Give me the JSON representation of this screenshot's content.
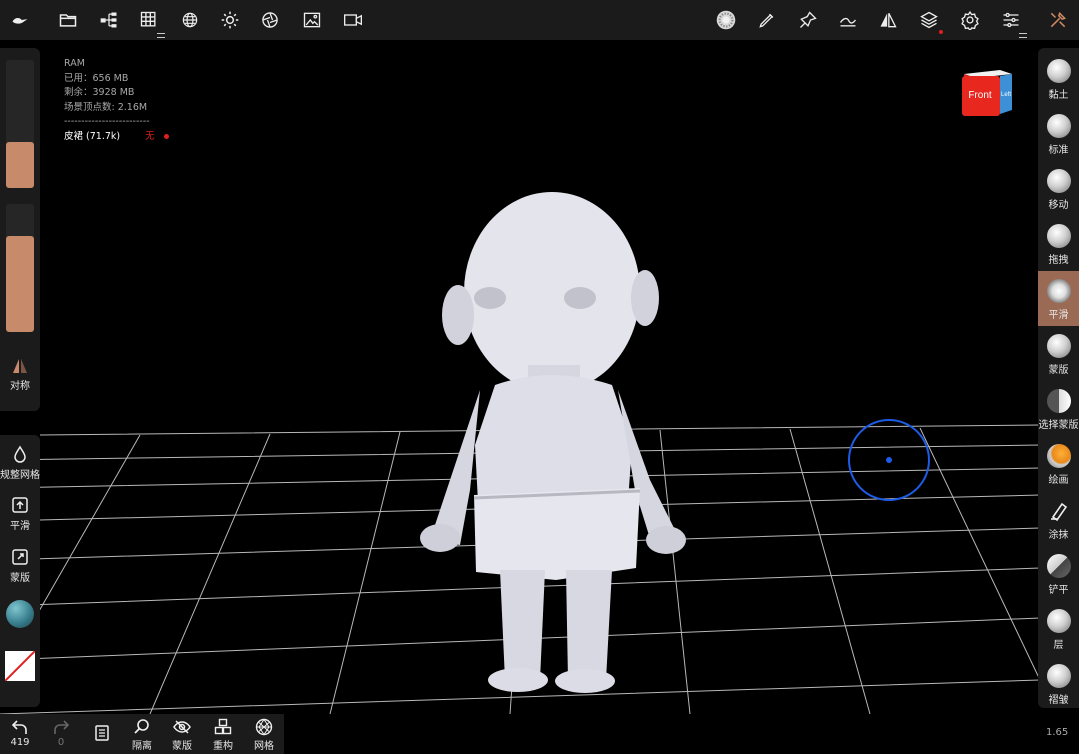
{
  "stats": {
    "ram_label": "RAM",
    "used": "已用：656 MB",
    "free": "剩余：3928 MB",
    "vertices": "场景顶点数: 2.16M",
    "divider": "-------------------------",
    "object_name": "皮裙 (71.7k)",
    "object_state": "无"
  },
  "view_cube": {
    "front_label": "Front",
    "side_label": "Left"
  },
  "left_panel": {
    "symmetry_label": "对称",
    "slider_top_level": 0.36,
    "slider_bottom_level": 0.75
  },
  "left_panel2": {
    "items": [
      {
        "label": "规整网格",
        "icon": "drop-icon"
      },
      {
        "label": "平滑",
        "icon": "upload-box-icon"
      },
      {
        "label": "蒙版",
        "icon": "corner-box-icon"
      }
    ],
    "material_color": "#3a7f8e",
    "color_swatch": "#ffffff"
  },
  "right_tools": [
    {
      "label": "黏土",
      "active": false
    },
    {
      "label": "标准",
      "active": false
    },
    {
      "label": "移动",
      "active": false
    },
    {
      "label": "拖拽",
      "active": false
    },
    {
      "label": "平滑",
      "active": true
    },
    {
      "label": "蒙版",
      "active": false
    },
    {
      "label": "选择蒙版",
      "active": false
    },
    {
      "label": "绘画",
      "active": false
    },
    {
      "label": "涂抹",
      "active": false
    },
    {
      "label": "铲平",
      "active": false
    },
    {
      "label": "层",
      "active": false
    },
    {
      "label": "褶皱",
      "active": false
    }
  ],
  "bottom_bar": {
    "undo_count": "419",
    "redo_count": "0",
    "items": [
      {
        "label": "隔离",
        "icon": "search-icon"
      },
      {
        "label": "蒙版",
        "icon": "eye-off-icon"
      },
      {
        "label": "重构",
        "icon": "cubes-icon"
      },
      {
        "label": "网格",
        "icon": "mesh-icon"
      }
    ]
  },
  "version": "1.65",
  "colors": {
    "accent": "#c78a6b",
    "panel": "#1b1b1b",
    "brush_cursor": "#1e5be6",
    "notification": "#e02020"
  }
}
